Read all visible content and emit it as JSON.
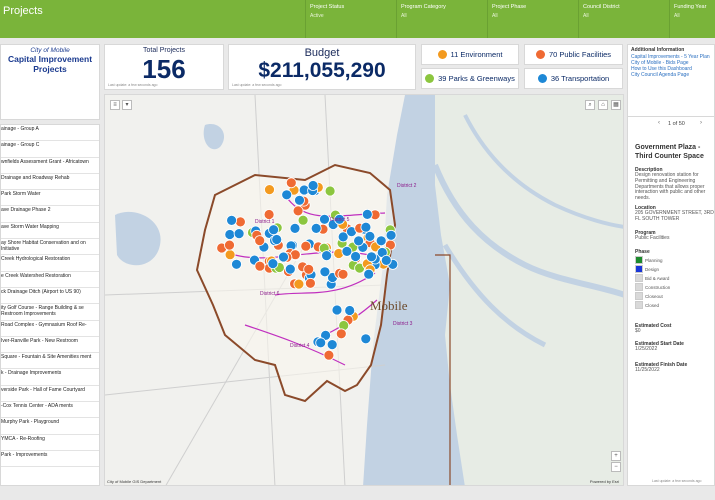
{
  "header": {
    "title": "Projects",
    "filters": [
      {
        "label": "Project Status",
        "value": "Active"
      },
      {
        "label": "Program Category",
        "value": "All"
      },
      {
        "label": "Project Phase",
        "value": "All"
      },
      {
        "label": "Council District",
        "value": "All"
      },
      {
        "label": "Funding Year",
        "value": "All"
      }
    ]
  },
  "logo": {
    "line1": "City of Mobile",
    "line2": "Capital Improvement Projects"
  },
  "kpi": {
    "total_label": "Total Projects",
    "total_value": "156",
    "total_updated": "Last update: a few seconds ago",
    "budget_label": "Budget",
    "budget_value": "$211,055,290",
    "budget_updated": "Last update: a few seconds ago"
  },
  "categories": [
    {
      "label": "11 Environment",
      "color": "#f39a1f"
    },
    {
      "label": "70 Public Facilities",
      "color": "#ef6a33"
    },
    {
      "label": "39 Parks & Greenways",
      "color": "#8cc63f"
    },
    {
      "label": "36 Transportation",
      "color": "#1e88d6"
    }
  ],
  "info": {
    "heading": "Additional Information",
    "links": [
      "Capital Improvements - 5 Year Plan",
      "City of Mobile - Bids Page",
      "How to Use this Dashboard",
      "City Council Agenda Page"
    ]
  },
  "project_list": [
    "ainage - Group A",
    "ainage - Group C",
    "wnfields Assessment Grant - Africatown",
    "Drainage and Roadway Rehab",
    "Park Storm Water",
    "ave Drainage Phase 2",
    "ave Storm Water Mapping",
    "ay Shore Habitat Conservation and on Initiative",
    "Creek Hydrological Restoration",
    "e Creek Watershed Restoration",
    "ck Drainage Ditch (Airport to US 90)",
    "ity Golf Course - Range Building & se Restroom Improvements",
    "Road Complex - Gymnasium Roof Re-",
    "Iver-Ranville Park - New Restroom",
    "Square - Fountain & Site Amenities ment",
    "k - Drainage Improvements",
    "verside Park - Hall of Fame Courtyard",
    "-Cox Tennis Center - ADA ments",
    "Murphy Park - Playground",
    "YMCA - Re-Roofing",
    "Park - Improvements"
  ],
  "map": {
    "place_label": "Mobile",
    "district_labels": [
      "District 2",
      "District 1",
      "District 5",
      "District 3",
      "District 4",
      "District 6"
    ],
    "credit_left": "City of Mobile GIS Department",
    "credit_right": "Powered by Esri"
  },
  "detail": {
    "pager": "1 of 50",
    "title": "Government Plaza - Third Counter Space",
    "description_label": "Description",
    "description": "Design renovation station for Permitting and Engineering Departments that allows proper interaction with public and other needs.",
    "location_label": "Location",
    "location": "205 GOVERNMENT STREET, 3RD FL SOUTH TOWER",
    "program_label": "Program",
    "program": "Public Facilities",
    "phase_label": "Phase",
    "phases": [
      {
        "label": "Planning",
        "color": "#1c8a2c"
      },
      {
        "label": "Design",
        "color": "#1936d8"
      },
      {
        "label": "Bid & Award",
        "color": "#d9d9d9"
      },
      {
        "label": "Construction",
        "color": "#d9d9d9"
      },
      {
        "label": "Closeout",
        "color": "#d9d9d9"
      },
      {
        "label": "Closed",
        "color": "#d9d9d9"
      }
    ],
    "cost_label": "Estimated Cost",
    "cost": "$0",
    "start_label": "Estimated Start Date",
    "start": "1/25/2022",
    "finish_label": "Estimated Finish Date",
    "finish": "11/25/2022",
    "updated": "Last update: a few seconds ago"
  }
}
